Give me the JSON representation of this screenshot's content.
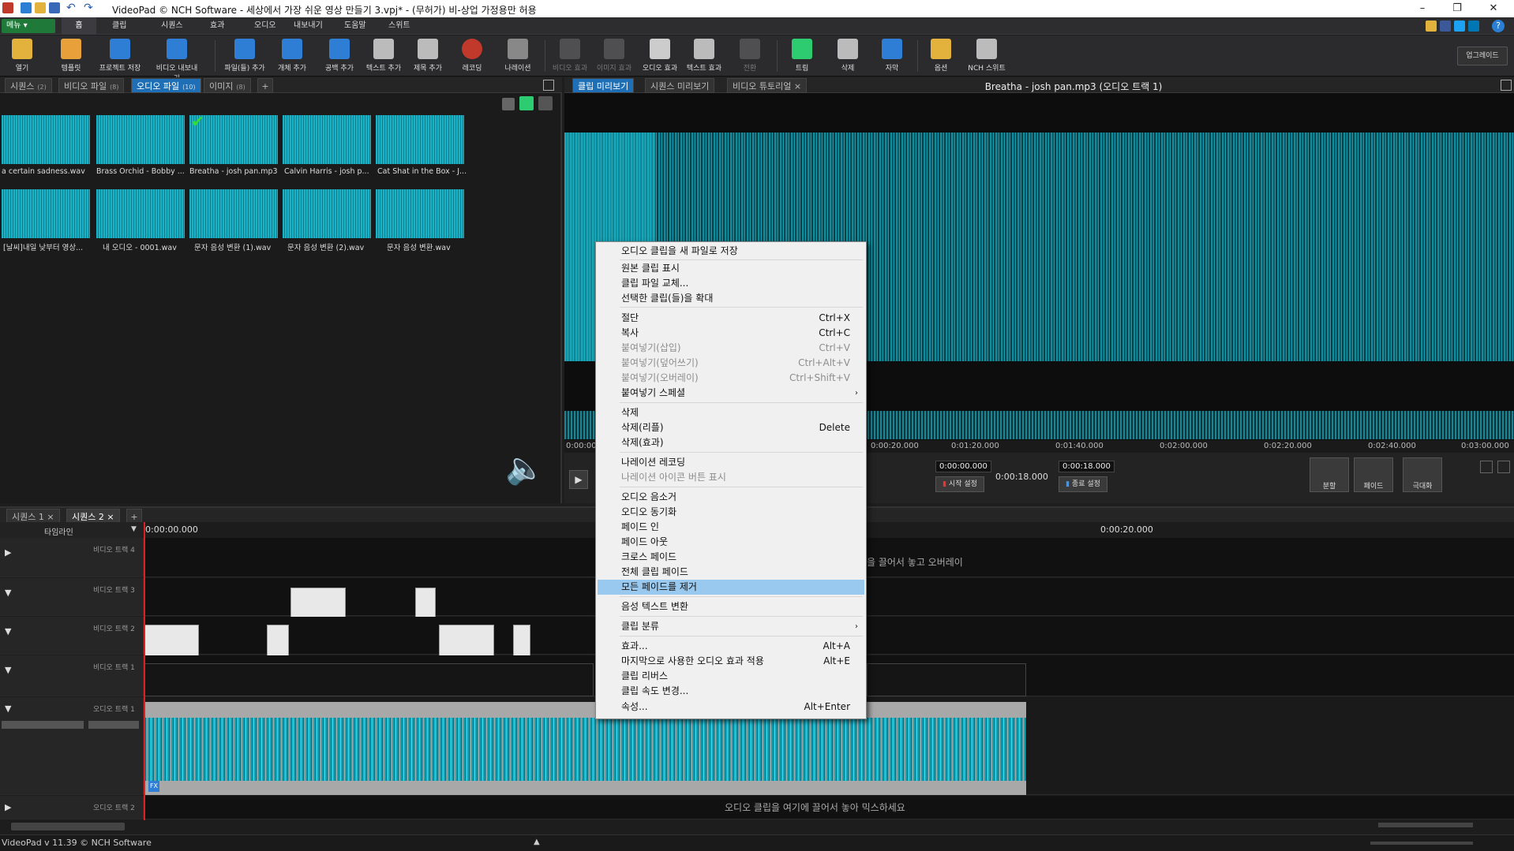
{
  "window": {
    "title": "VideoPad © NCH Software - 세상에서 가장 쉬운 영상 만들기 3.vpj* - (무허가) 비-상업 가정용만 허용"
  },
  "menubar": {
    "menu_button": "메뉴 ▾",
    "tabs": [
      "홈",
      "클립",
      "시퀀스",
      "효과",
      "오디오",
      "내보내기",
      "도움말",
      "스위트"
    ]
  },
  "toolbar": {
    "buttons": [
      {
        "label": "열기",
        "icon": "open-folder-icon"
      },
      {
        "label": "템플릿",
        "icon": "template-icon"
      },
      {
        "label": "프로젝트 저장",
        "icon": "save-icon"
      },
      {
        "label": "비디오 내보내기",
        "icon": "export-video-icon"
      },
      {
        "label": "파일(들) 추가",
        "icon": "add-file-icon"
      },
      {
        "label": "개체 추가",
        "icon": "add-object-icon"
      },
      {
        "label": "공백 추가",
        "icon": "add-blank-icon"
      },
      {
        "label": "텍스트 추가",
        "icon": "add-text-icon"
      },
      {
        "label": "제목 추가",
        "icon": "add-title-icon"
      },
      {
        "label": "레코딩",
        "icon": "record-icon"
      },
      {
        "label": "나레이션",
        "icon": "microphone-icon"
      },
      {
        "label": "비디오 효과",
        "icon": "video-effect-icon"
      },
      {
        "label": "이미지 효과",
        "icon": "image-effect-icon"
      },
      {
        "label": "오디오 효과",
        "icon": "audio-effect-icon"
      },
      {
        "label": "텍스트 효과",
        "icon": "text-effect-icon"
      },
      {
        "label": "전환",
        "icon": "transition-icon"
      },
      {
        "label": "트림",
        "icon": "trim-icon"
      },
      {
        "label": "삭제",
        "icon": "trash-icon"
      },
      {
        "label": "자막",
        "icon": "subtitle-icon"
      },
      {
        "label": "옵션",
        "icon": "options-icon"
      },
      {
        "label": "NCH 스위트",
        "icon": "nch-suite-icon"
      }
    ],
    "upgrade": "업그레이드"
  },
  "bin": {
    "tabs": [
      {
        "label": "시퀀스",
        "count": "(2)"
      },
      {
        "label": "비디오 파일",
        "count": "(8)"
      },
      {
        "label": "오디오 파일",
        "count": "(10)"
      },
      {
        "label": "이미지",
        "count": "(8)"
      }
    ],
    "add_tab": "+",
    "clips": [
      "a certain sadness.wav",
      "Brass Orchid - Bobby ...",
      "Breatha - josh pan.mp3",
      "Calvin Harris - josh p...",
      "Cat Shat in the Box - J...",
      "[날씨]내일 낮부터 영상...",
      "내 오디오 - 0001.wav",
      "문자 음성 변환 (1).wav",
      "문자 음성 변환 (2).wav",
      "문자 음성 변환.wav"
    ]
  },
  "preview": {
    "tabs": [
      "클립 미리보기",
      "시퀀스 미리보기",
      "비디오 튜토리얼"
    ],
    "title": "Breatha - josh pan.mp3 (오디오 트랙 1)",
    "ruler": [
      "0:00:00",
      "0:00:20.000",
      "0:01:20.000",
      "0:01:40.000",
      "0:02:00.000",
      "0:02:20.000",
      "0:02:40.000",
      "0:03:00.000"
    ],
    "start_time": "0:00:00.000",
    "duration": "0:00:18.000",
    "end_time": "0:00:18.000",
    "start_set": "시작 설정",
    "end_set": "종료 설정",
    "split": "분할",
    "fade": "페이드",
    "maximize": "극대화"
  },
  "sequence": {
    "tabs": [
      "시퀀스 1",
      "시퀀스 2"
    ],
    "add_tab": "+",
    "timeline_label": "타임라인",
    "ruler": [
      "0:00:00.000",
      "0:00:20.000"
    ],
    "tracks": {
      "video4": "비디오 트랙 4",
      "video3": "비디오 트랙 3",
      "video2": "비디오 트랙 2",
      "video1": "비디오 트랙 1",
      "audio1": "오디오 트랙 1",
      "audio2": "오디오 트랙 2"
    },
    "overlay_hint": "을 끌어서 놓고 오버레이",
    "audio_hint": "오디오 클립을 여기에 끌어서 놓아 믹스하세요"
  },
  "context_menu": {
    "items": [
      {
        "label": "오디오 클립을 새 파일로 저장"
      },
      {
        "label": "원본 클립 표시"
      },
      {
        "label": "클립 파일 교체..."
      },
      {
        "label": "선택한 클립(들)을 확대"
      },
      {
        "label": "절단",
        "shortcut": "Ctrl+X"
      },
      {
        "label": "복사",
        "shortcut": "Ctrl+C"
      },
      {
        "label": "붙여넣기(삽입)",
        "shortcut": "Ctrl+V"
      },
      {
        "label": "붙여넣기(덮어쓰기)",
        "shortcut": "Ctrl+Alt+V"
      },
      {
        "label": "붙여넣기(오버레이)",
        "shortcut": "Ctrl+Shift+V"
      },
      {
        "label": "붙여넣기 스페셜"
      },
      {
        "label": "삭제"
      },
      {
        "label": "삭제(리플)",
        "shortcut": "Delete"
      },
      {
        "label": "삭제(효과)"
      },
      {
        "label": "나레이션 레코딩"
      },
      {
        "label": "나레이션 아이콘 버튼 표시"
      },
      {
        "label": "오디오 음소거"
      },
      {
        "label": "오디오 동기화"
      },
      {
        "label": "페이드 인"
      },
      {
        "label": "페이드 아웃"
      },
      {
        "label": "크로스 페이드"
      },
      {
        "label": "전체 클립 페이드"
      },
      {
        "label": "모든 페이드를 제거"
      },
      {
        "label": "음성 텍스트 변환"
      },
      {
        "label": "클립 분류"
      },
      {
        "label": "효과...",
        "shortcut": "Alt+A"
      },
      {
        "label": "마지막으로 사용한 오디오 효과 적용",
        "shortcut": "Alt+E"
      },
      {
        "label": "클립 리버스"
      },
      {
        "label": "클립 속도 변경..."
      },
      {
        "label": "속성...",
        "shortcut": "Alt+Enter"
      }
    ]
  },
  "status": {
    "text": "VideoPad v 11.39 © NCH Software"
  },
  "colors": {
    "accent": "#1e6fb5",
    "waveform": "#19b3c7",
    "menu_highlight": "#99c9ef"
  }
}
